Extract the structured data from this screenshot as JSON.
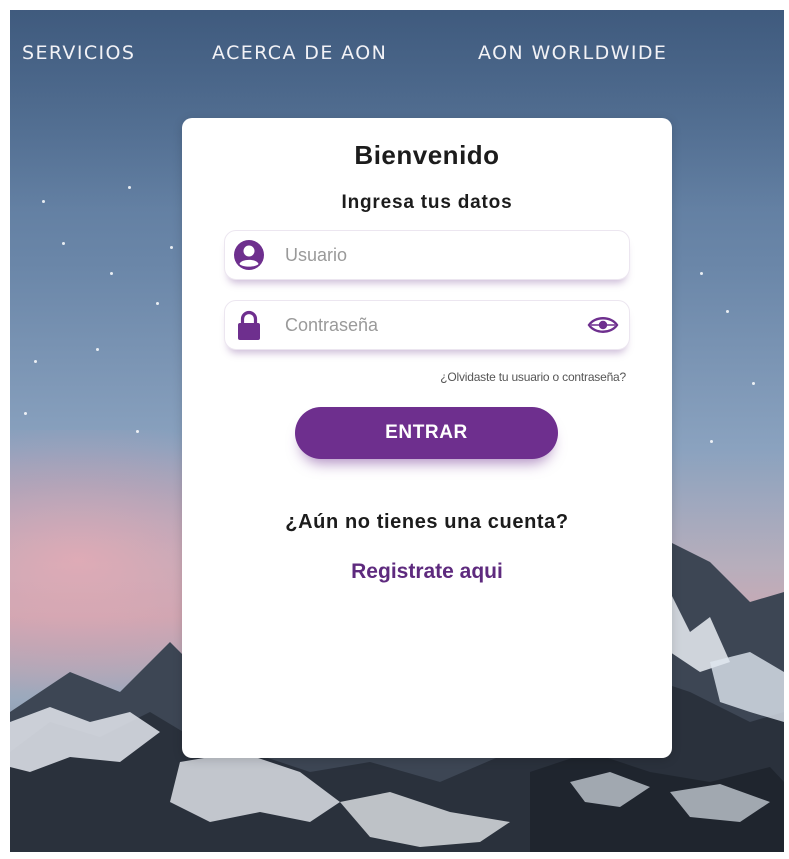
{
  "nav": {
    "items": [
      {
        "label": "SERVICIOS"
      },
      {
        "label": "ACERCA DE AON"
      },
      {
        "label": "AON WORLDWIDE"
      }
    ]
  },
  "login": {
    "title": "Bienvenido",
    "subtitle": "Ingresa tus datos",
    "username": {
      "placeholder": "Usuario",
      "value": "",
      "icon": "user-icon"
    },
    "password": {
      "placeholder": "Contraseña",
      "value": "",
      "icon": "lock-icon",
      "toggle_icon": "eye-icon"
    },
    "forgot_link": "¿Olvidaste tu usuario o contraseña?",
    "submit_label": "ENTRAR",
    "no_account": "¿Aún no tienes una cuenta?",
    "register_link": "Registrate aqui"
  },
  "colors": {
    "accent": "#6e2f8e",
    "link": "#5e2a7e"
  }
}
